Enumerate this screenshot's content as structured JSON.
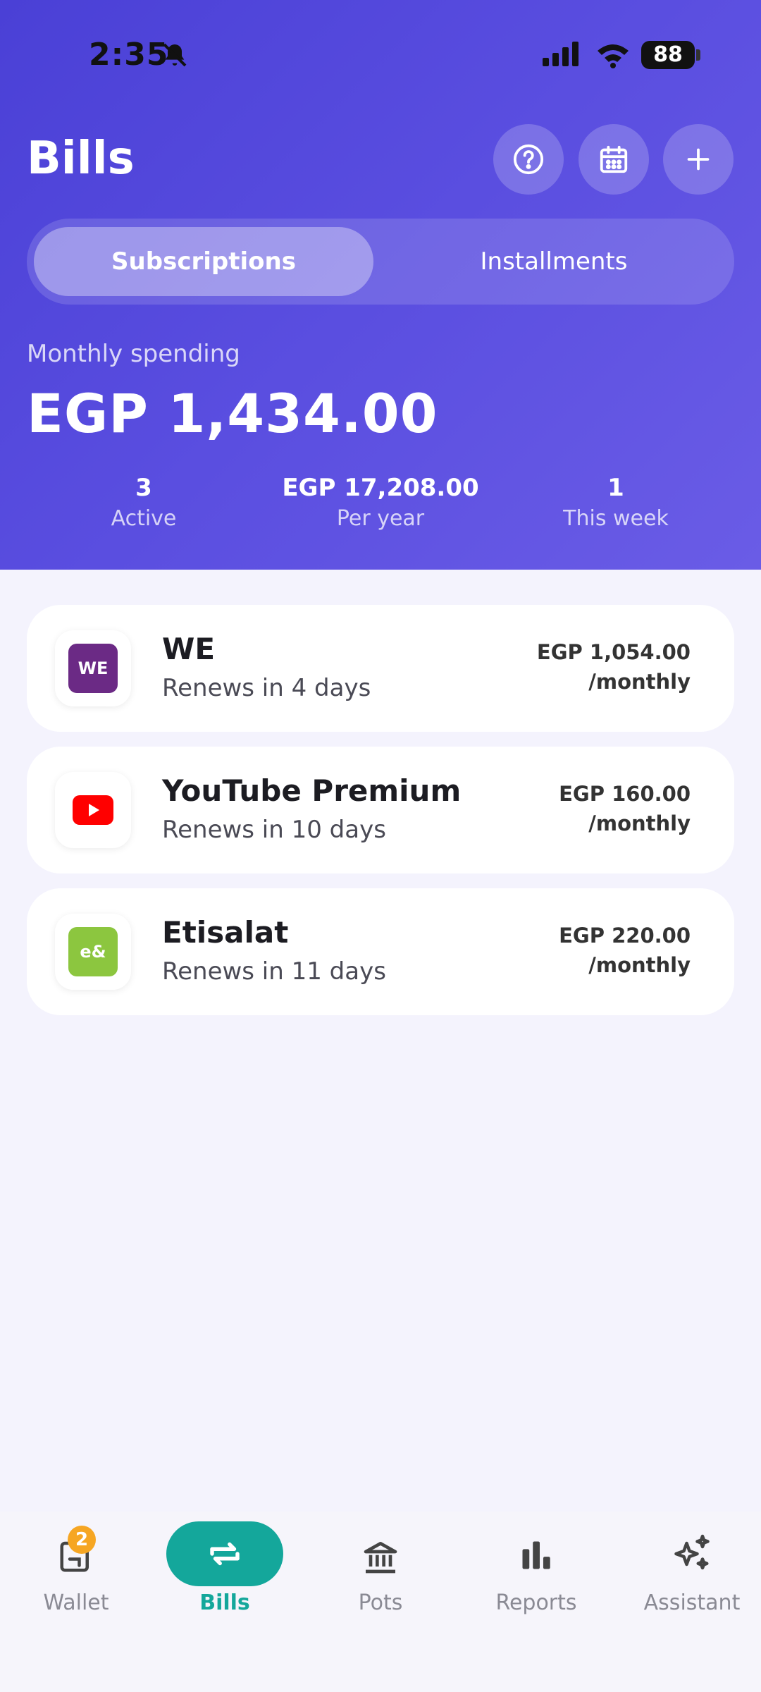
{
  "status_bar": {
    "time": "2:35",
    "battery": "88"
  },
  "header": {
    "title": "Bills",
    "tabs": [
      {
        "label": "Subscriptions",
        "active": true
      },
      {
        "label": "Installments",
        "active": false
      }
    ],
    "spending_label": "Monthly spending",
    "spending_value": "EGP 1,434.00",
    "stats": [
      {
        "value": "3",
        "label": "Active"
      },
      {
        "value": "EGP 17,208.00",
        "label": "Per year"
      },
      {
        "value": "1",
        "label": "This week"
      }
    ]
  },
  "subscriptions": [
    {
      "name": "WE",
      "renews": "Renews in 4 days",
      "amount": "EGP 1,054.00",
      "period": "/monthly",
      "logo_text": "WE",
      "logo_color": "#6b2a85"
    },
    {
      "name": "YouTube Premium",
      "renews": "Renews in 10 days",
      "amount": "EGP 160.00",
      "period": "/monthly",
      "logo_text": "",
      "logo_color": "#ff0000"
    },
    {
      "name": "Etisalat",
      "renews": "Renews in 11 days",
      "amount": "EGP 220.00",
      "period": "/monthly",
      "logo_text": "e&",
      "logo_color": "#8cc63f"
    }
  ],
  "nav": {
    "items": [
      {
        "label": "Wallet",
        "icon": "wallet-icon",
        "badge": "2"
      },
      {
        "label": "Bills",
        "icon": "repeat-icon",
        "active": true
      },
      {
        "label": "Pots",
        "icon": "bank-icon"
      },
      {
        "label": "Reports",
        "icon": "bar-chart-icon"
      },
      {
        "label": "Assistant",
        "icon": "sparkle-icon"
      }
    ]
  },
  "colors": {
    "header": "#5246dc",
    "accent": "#14a79b",
    "background": "#f4f3fd"
  }
}
